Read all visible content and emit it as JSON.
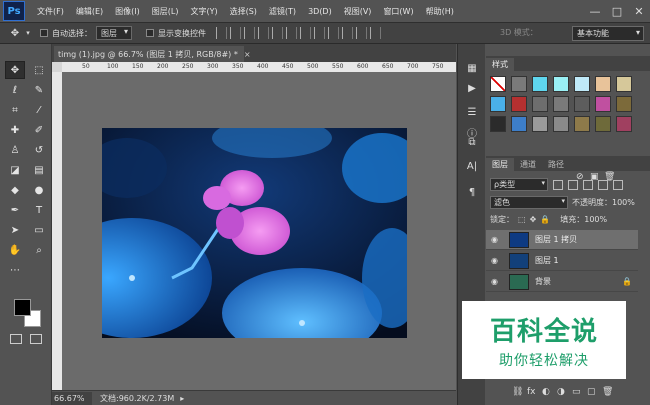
{
  "app": {
    "logo": "Ps"
  },
  "menu": [
    "文件(F)",
    "编辑(E)",
    "图像(I)",
    "图层(L)",
    "文字(Y)",
    "选择(S)",
    "滤镜(T)",
    "3D(D)",
    "视图(V)",
    "窗口(W)",
    "帮助(H)"
  ],
  "window_controls": [
    "—",
    "□",
    "✕"
  ],
  "options": {
    "auto_select_label": "自动选择：",
    "auto_select_value": "图层",
    "show_transform_label": "显示变换控件",
    "mode_3d_label": "3D 模式：",
    "workspace": "基本功能"
  },
  "document": {
    "tab_title": "timg (1).jpg @ 66.7% (图层 1 拷贝, RGB/8#) *",
    "close_glyph": "×",
    "ruler_ticks": [
      "50",
      "100",
      "150",
      "200",
      "250",
      "300",
      "350",
      "400",
      "450",
      "500",
      "550",
      "600",
      "650",
      "700",
      "750"
    ],
    "zoom": "66.67%",
    "doc_info": "文档:960.2K/2.73M",
    "status_arrow": "▸"
  },
  "styles_panel": {
    "tab": "样式",
    "swatch_colors": [
      "#ffffff",
      "#7a7a7a",
      "#5fd6ee",
      "#9af0f5",
      "#bfe9f8",
      "#e8c39a",
      "#d6c89a",
      "#4ab0e8",
      "#b53030",
      "#6e6e6e",
      "#7a7a7a",
      "#5d5d5d",
      "#c050a0",
      "#7c6a3a",
      "#2b2b2b",
      "#3d7ec9",
      "#9a9a9a",
      "#8a8a8a",
      "#8e7a4a",
      "#6e6a3a",
      "#a04060"
    ]
  },
  "layers_panel": {
    "tabs": [
      "图层",
      "通道",
      "路径"
    ],
    "filter_label": "ρ类型",
    "blend_mode": "滤色",
    "opacity_label": "不透明度：",
    "opacity_value": "100%",
    "lock_label": "锁定：",
    "fill_label": "填充：",
    "fill_value": "100%",
    "layers": [
      {
        "name": "图层 1 拷贝",
        "selected": true,
        "locked": false,
        "thumb": "#0e3a82"
      },
      {
        "name": "图层 1",
        "selected": false,
        "locked": false,
        "thumb": "#12407a"
      },
      {
        "name": "背景",
        "selected": false,
        "locked": true,
        "thumb": "#2a6a52"
      }
    ],
    "footer_icons": [
      "link-icon",
      "fx-icon",
      "mask-icon",
      "adjustment-icon",
      "folder-icon",
      "new-layer-icon",
      "trash-icon"
    ]
  },
  "watermark": {
    "main": "百科全说",
    "sub": "助你轻松解决"
  }
}
